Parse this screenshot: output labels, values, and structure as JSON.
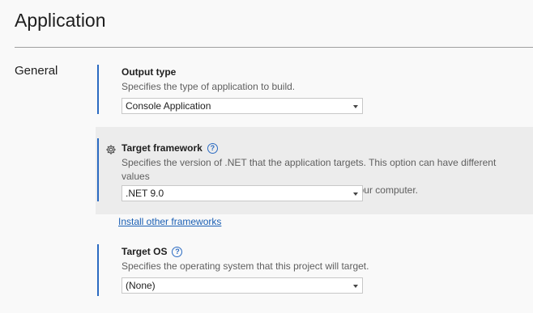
{
  "header": {
    "title": "Application"
  },
  "section": {
    "label": "General"
  },
  "output_type": {
    "label": "Output type",
    "description": "Specifies the type of application to build.",
    "value": "Console Application"
  },
  "target_framework": {
    "label": "Target framework",
    "description_line1": "Specifies the version of .NET that the application targets. This option can have different values",
    "description_line2": "depending on which versions of .NET are installed on your computer.",
    "value": ".NET 9.0",
    "icon": "gear-icon",
    "help_icon": "help-icon"
  },
  "install_link": {
    "label": "Install other frameworks"
  },
  "target_os": {
    "label": "Target OS",
    "description": "Specifies the operating system that this project will target.",
    "value": "(None)",
    "help_icon": "help-icon"
  },
  "colors": {
    "accent_bar": "#2b6bc2",
    "highlight_bg": "#ececec",
    "link": "#1a5fb4"
  }
}
